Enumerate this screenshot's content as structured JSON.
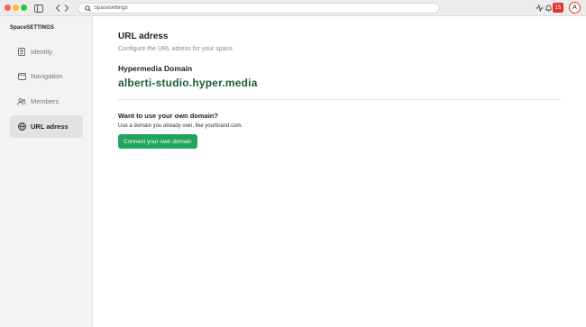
{
  "addressbar": {
    "placeholder": "Spacesettings"
  },
  "notifications": {
    "count": "15"
  },
  "avatar": {
    "initial": "A"
  },
  "sidebar": {
    "title": "SpaceSETTINGS",
    "items": [
      {
        "label": "Identity",
        "icon": "identity-icon",
        "active": false
      },
      {
        "label": "Navigation",
        "icon": "navigation-icon",
        "active": false
      },
      {
        "label": "Members",
        "icon": "members-icon",
        "active": false
      },
      {
        "label": "URL adress",
        "icon": "globe-icon",
        "active": true
      }
    ]
  },
  "main": {
    "title": "URL adress",
    "subtitle": "Configure the URL adress for your space",
    "domain_label": "Hypermedia Domain",
    "domain_value": "alberti-studio.hyper.media",
    "own_domain_title": "Want to use your own domain?",
    "own_domain_sub": "Use a domain you already own, like yourbrand.com.",
    "connect_button": "Connect your own domain"
  },
  "colors": {
    "accent_green": "#1fa55e",
    "domain_green": "#1b5e38",
    "badge_red": "#e5352b"
  }
}
